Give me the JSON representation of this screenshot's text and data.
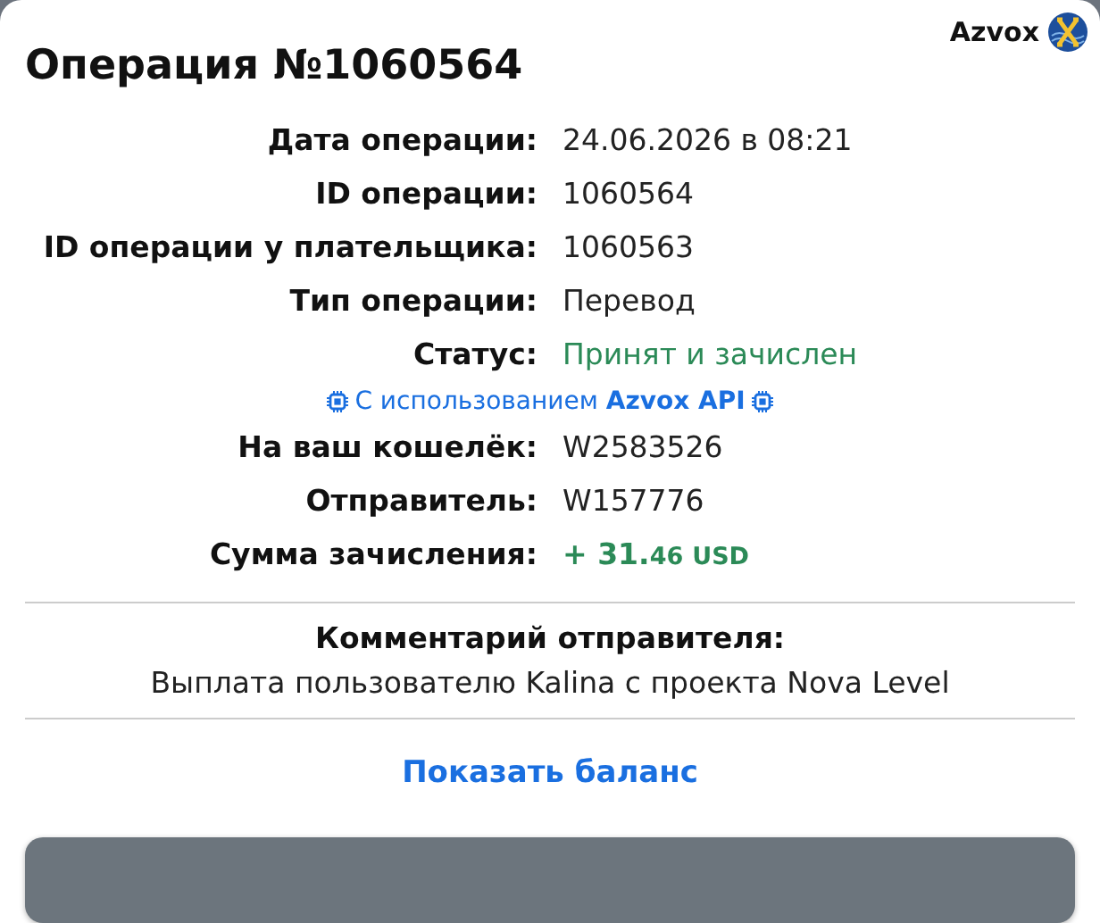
{
  "brand": {
    "name": "Azvox"
  },
  "title": "Операция №1060564",
  "details": [
    {
      "kind": "text",
      "label": "Дата операции:",
      "value": "24.06.2026 в 08:21"
    },
    {
      "kind": "text",
      "label": "ID операции:",
      "value": "1060564"
    },
    {
      "kind": "text",
      "label": "ID операции у плательщика:",
      "value": "1060563"
    },
    {
      "kind": "text",
      "label": "Тип операции:",
      "value": "Перевод"
    },
    {
      "kind": "status",
      "label": "Статус:",
      "value": "Принят и зачислен"
    }
  ],
  "api_note": "С использованием **Azvox API**",
  "details_2": [
    {
      "kind": "text",
      "label": "На ваш кошелёк:",
      "value": "W2583526"
    },
    {
      "kind": "text",
      "label": "Отправитель:",
      "value": "W157776"
    },
    {
      "kind": "amount",
      "label": "Сумма зачисления:",
      "value": "+ 31.",
      "fraction": "46",
      "currency": "USD"
    }
  ],
  "comment": {
    "title": "Комментарий отправителя:",
    "text": "Выплата пользователю Kalina с проекта Nova Level"
  },
  "balance_link": "Показать баланс"
}
